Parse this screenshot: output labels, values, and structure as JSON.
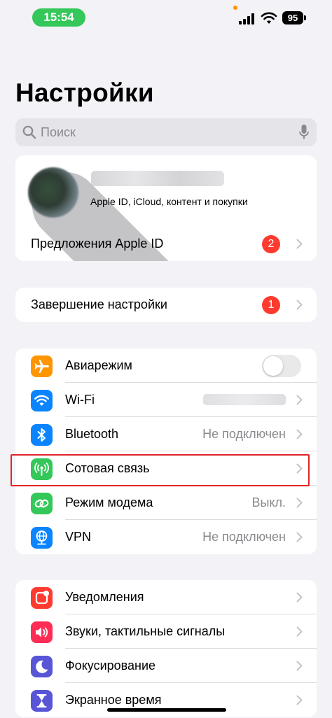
{
  "status_bar": {
    "time": "15:54",
    "battery": "95",
    "colors": {
      "time_pill": "#34c759",
      "privacy_dot": "#ff9500"
    }
  },
  "page": {
    "title": "Настройки",
    "search_placeholder": "Поиск"
  },
  "account_group": {
    "profile_subtitle": "Apple ID, iCloud, контент и покупки",
    "suggestions_label": "Предложения Apple ID",
    "suggestions_badge": "2"
  },
  "finish_group": {
    "label": "Завершение настройки",
    "badge": "1"
  },
  "connectivity_group": [
    {
      "label": "Авиарежим",
      "icon": "airplane-icon",
      "color": "#ff9500",
      "toggle": false
    },
    {
      "label": "Wi-Fi",
      "icon": "wifi-icon",
      "color": "#0a84ff",
      "value": ""
    },
    {
      "label": "Bluetooth",
      "icon": "bluetooth-icon",
      "color": "#0a84ff",
      "value": "Не подключен"
    },
    {
      "label": "Сотовая связь",
      "icon": "antenna-icon",
      "color": "#34c759",
      "value": "",
      "highlighted": true
    },
    {
      "label": "Режим модема",
      "icon": "link-icon",
      "color": "#34c759",
      "value": "Выкл."
    },
    {
      "label": "VPN",
      "icon": "globe-icon",
      "color": "#0a84ff",
      "value": "Не подключен"
    }
  ],
  "notifications_group": [
    {
      "label": "Уведомления",
      "icon": "bell-icon",
      "color": "#ff3b30"
    },
    {
      "label": "Звуки, тактильные сигналы",
      "icon": "speaker-icon",
      "color": "#ff2d55"
    },
    {
      "label": "Фокусирование",
      "icon": "moon-icon",
      "color": "#5856d6"
    },
    {
      "label": "Экранное время",
      "icon": "hourglass-icon",
      "color": "#5856d6"
    }
  ]
}
